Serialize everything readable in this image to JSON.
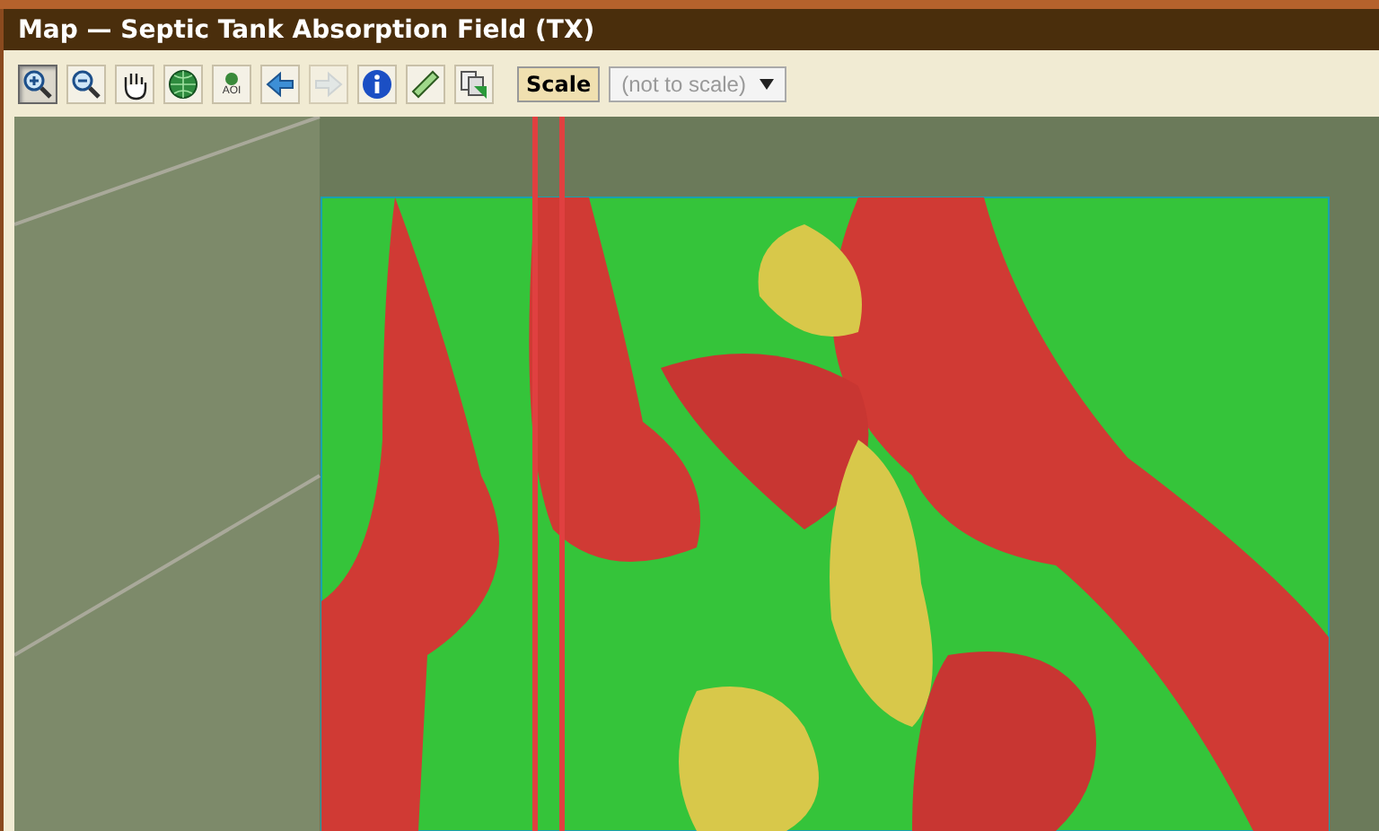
{
  "window": {
    "title": "Map — Septic Tank Absorption Field (TX)"
  },
  "toolbar": {
    "tools": [
      {
        "kind": "zoom-in",
        "selected": true,
        "disabled": false
      },
      {
        "kind": "zoom-out",
        "selected": false,
        "disabled": false
      },
      {
        "kind": "pan",
        "selected": false,
        "disabled": false
      },
      {
        "kind": "globe",
        "selected": false,
        "disabled": false
      },
      {
        "kind": "aoi",
        "label": "AOI",
        "selected": false,
        "disabled": false
      },
      {
        "kind": "back",
        "selected": false,
        "disabled": false
      },
      {
        "kind": "forward",
        "selected": false,
        "disabled": true
      },
      {
        "kind": "info",
        "selected": false,
        "disabled": false
      },
      {
        "kind": "measure",
        "selected": false,
        "disabled": false
      },
      {
        "kind": "copy",
        "selected": false,
        "disabled": false
      }
    ],
    "scale_button": "Scale",
    "scale_select": {
      "value": "(not to scale)",
      "disabled": true
    }
  }
}
